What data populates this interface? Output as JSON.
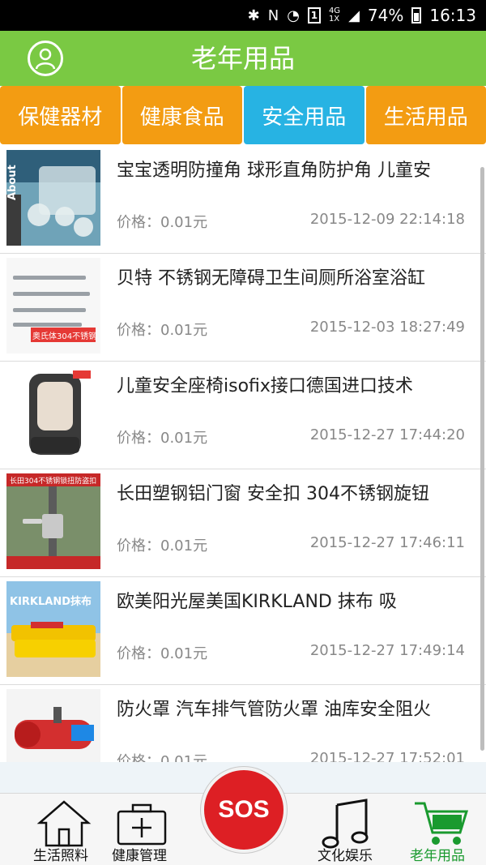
{
  "status_bar": {
    "battery": "74%",
    "time": "16:13",
    "network_top": "4G",
    "network_bottom": "1X",
    "sim_slot": "1"
  },
  "header": {
    "title": "老年用品",
    "avatar_icon": "user-icon"
  },
  "tabs": [
    {
      "label": "保健器材",
      "active": false
    },
    {
      "label": "健康食品",
      "active": false
    },
    {
      "label": "安全用品",
      "active": true
    },
    {
      "label": "生活用品",
      "active": false
    }
  ],
  "colors": {
    "header": "#7ac943",
    "tab": "#f39c12",
    "tab_active": "#27b3e3",
    "sos": "#dd1f24",
    "nav_active": "#1a9a2f"
  },
  "products": [
    {
      "title": "宝宝透明防撞角 球形直角防护角 儿童安",
      "price": "价格：0.01元",
      "date": "2015-12-09 22:14:18",
      "thumb_text": "About"
    },
    {
      "title": "贝特 不锈钢无障碍卫生间厕所浴室浴缸",
      "price": "价格：0.01元",
      "date": "2015-12-03 18:27:49",
      "thumb_text": "奥氏体304不锈钢"
    },
    {
      "title": "儿童安全座椅isofix接口德国进口技术",
      "price": "价格：0.01元",
      "date": "2015-12-27 17:44:20",
      "thumb_text": ""
    },
    {
      "title": "长田塑钢铝门窗 安全扣 304不锈钢旋钮",
      "price": "价格：0.01元",
      "date": "2015-12-27 17:46:11",
      "thumb_text": "长田304不锈钢锁扭防盗扣"
    },
    {
      "title": "欧美阳光屋美国KIRKLAND 抹布 吸",
      "price": "价格：0.01元",
      "date": "2015-12-27 17:49:14",
      "thumb_text": "KIRKLAND抹布"
    },
    {
      "title": "防火罩 汽车排气管防火罩 油库安全阻火",
      "price": "价格：0.01元",
      "date": "2015-12-27 17:52:01",
      "thumb_text": ""
    }
  ],
  "bottom_nav": [
    {
      "label": "生活照料",
      "icon": "house-icon"
    },
    {
      "label": "健康管理",
      "icon": "medical-kit-icon"
    },
    {
      "label": "文化娱乐",
      "icon": "music-note-icon"
    },
    {
      "label": "老年用品",
      "icon": "shopping-cart-icon",
      "active": true
    }
  ],
  "sos_label": "SOS"
}
